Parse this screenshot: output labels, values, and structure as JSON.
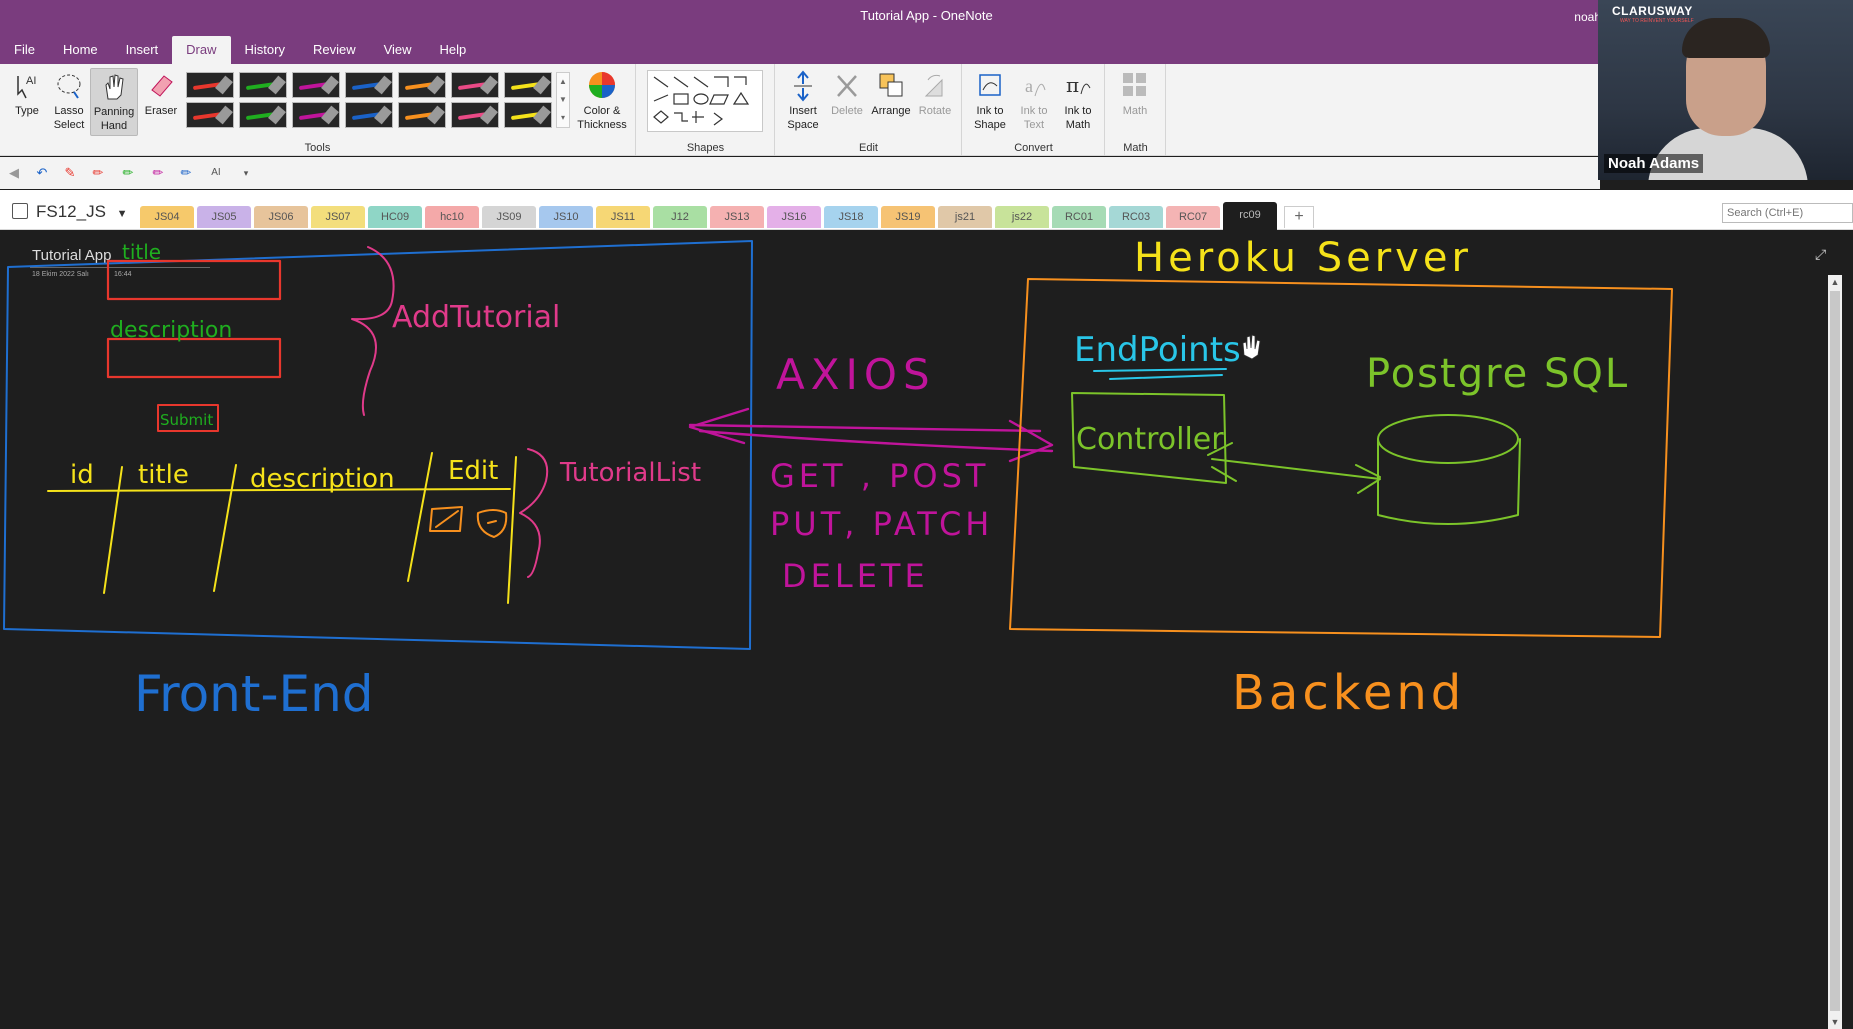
{
  "window": {
    "title": "Tutorial App  -  OneNote",
    "user": "noah"
  },
  "menu": [
    "File",
    "Home",
    "Insert",
    "Draw",
    "History",
    "Review",
    "View",
    "Help"
  ],
  "ribbon": {
    "tools": {
      "type": "Type",
      "lasso_a": "Lasso",
      "lasso_b": "Select",
      "pan_a": "Panning",
      "pan_b": "Hand",
      "eraser": "Eraser",
      "label": "Tools"
    },
    "color_a": "Color &",
    "color_b": "Thickness",
    "shapes_label": "Shapes",
    "edit": {
      "insert_a": "Insert",
      "insert_b": "Space",
      "delete": "Delete",
      "arrange": "Arrange",
      "rotate": "Rotate",
      "label": "Edit"
    },
    "convert": {
      "ink_shape_a": "Ink to",
      "ink_shape_b": "Shape",
      "ink_text_a": "Ink to",
      "ink_text_b": "Text",
      "ink_math_a": "Ink to",
      "ink_math_b": "Math",
      "label": "Convert"
    },
    "math": {
      "btn": "Math",
      "label": "Math"
    },
    "pen_colors": [
      "#e8372d",
      "#1fae1f",
      "#c0149b",
      "#1a62c8",
      "#f7901e",
      "#ea4a86",
      "#f5e21a"
    ]
  },
  "notebook": "FS12_JS",
  "sections": [
    {
      "label": "JS04",
      "color": "#f6c96b"
    },
    {
      "label": "JS05",
      "color": "#c9b2e8"
    },
    {
      "label": "JS06",
      "color": "#e7c49b"
    },
    {
      "label": "JS07",
      "color": "#f3de7c"
    },
    {
      "label": "HC09",
      "color": "#8fd6c6"
    },
    {
      "label": "hc10",
      "color": "#f4a9a9"
    },
    {
      "label": "JS09",
      "color": "#d5d5d5"
    },
    {
      "label": "JS10",
      "color": "#a6c8ee"
    },
    {
      "label": "JS11",
      "color": "#f6d775"
    },
    {
      "label": "J12",
      "color": "#a9dfa3"
    },
    {
      "label": "JS13",
      "color": "#f5b1b1"
    },
    {
      "label": "JS16",
      "color": "#e4b0e8"
    },
    {
      "label": "JS18",
      "color": "#a6d3ee"
    },
    {
      "label": "JS19",
      "color": "#f6c374"
    },
    {
      "label": "js21",
      "color": "#e0c8a8"
    },
    {
      "label": "js22",
      "color": "#c8e39a"
    },
    {
      "label": "RC01",
      "color": "#a6dbb5"
    },
    {
      "label": "RC03",
      "color": "#a5d8d6"
    },
    {
      "label": "RC07",
      "color": "#f4b4b4"
    },
    {
      "label": "rc09",
      "color": "#1e1e1e",
      "active": true
    }
  ],
  "search_placeholder": "Search (Ctrl+E)",
  "page": {
    "title": "Tutorial App",
    "date": "18 Ekim 2022 Salı",
    "time": "16:44"
  },
  "ink": {
    "heroku": "Heroku Server",
    "endpoints": "EndPoints",
    "postgre": "Postgre SQL",
    "controller": "Controller",
    "axios": "AXIOS",
    "methods": [
      "GET , POST",
      "PUT, PATCH",
      "DELETE"
    ],
    "title_label": "title",
    "description_label": "description",
    "submit": "Submit",
    "add_tutorial": "AddTutorial",
    "tutorial_list": "TutorialList",
    "cols": [
      "id",
      "title",
      "description",
      "Edit"
    ],
    "frontend": "Front-End",
    "backend": "Backend"
  },
  "webcam": {
    "brand": "CLARUSWAY",
    "tagline": "WAY TO REINVENT YOURSELF",
    "name": "Noah Adams"
  }
}
